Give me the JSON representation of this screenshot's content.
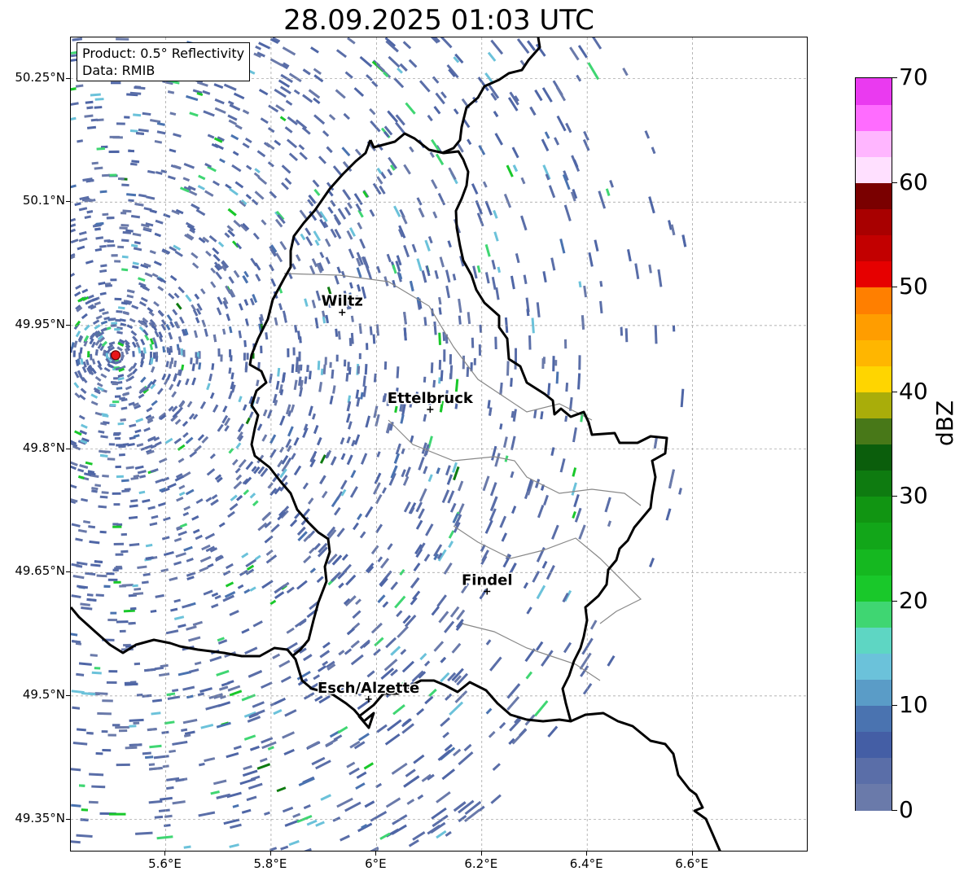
{
  "title": "28.09.2025 01:03 UTC",
  "info": {
    "product": "Product: 0.5° Reflectivity",
    "source": "Data: RMIB"
  },
  "map": {
    "lon_range": [
      5.42,
      6.82
    ],
    "lat_range": [
      49.31,
      50.3
    ],
    "radar_site": {
      "lon": 5.505,
      "lat": 49.914,
      "color": "#e8161a"
    },
    "lat_ticks": [
      "50.25°N",
      "50.1°N",
      "49.95°N",
      "49.8°N",
      "49.65°N",
      "49.5°N",
      "49.35°N"
    ],
    "lon_ticks": [
      "5.6°E",
      "5.8°E",
      "6°E",
      "6.2°E",
      "6.4°E",
      "6.6°E"
    ],
    "cities": [
      {
        "name": "Wiltz",
        "lon": 5.935,
        "lat": 49.966
      },
      {
        "name": "Ettelbruck",
        "lon": 6.102,
        "lat": 49.848
      },
      {
        "name": "Findel",
        "lon": 6.21,
        "lat": 49.627
      },
      {
        "name": "Esch/Alzette",
        "lon": 5.985,
        "lat": 49.496
      }
    ]
  },
  "colorbar": {
    "label": "dBZ",
    "min": 0,
    "max": 70,
    "tick_labels": [
      "0",
      "10",
      "20",
      "30",
      "40",
      "50",
      "60",
      "70"
    ],
    "colors": [
      "#6a7aaa",
      "#5a6ea8",
      "#445ea5",
      "#4a73b0",
      "#5a9cc7",
      "#6bc2da",
      "#5ed6c3",
      "#3fd672",
      "#19c82a",
      "#15b820",
      "#12a619",
      "#119512",
      "#0e7b10",
      "#0b5e0c",
      "#487818",
      "#a9ad0a",
      "#ffd500",
      "#ffb600",
      "#ff9d00",
      "#ff7f00",
      "#e60000",
      "#c20000",
      "#a80000",
      "#7a0000",
      "#ffe0ff",
      "#ffb6ff",
      "#ff6cff",
      "#ea3af0"
    ]
  }
}
